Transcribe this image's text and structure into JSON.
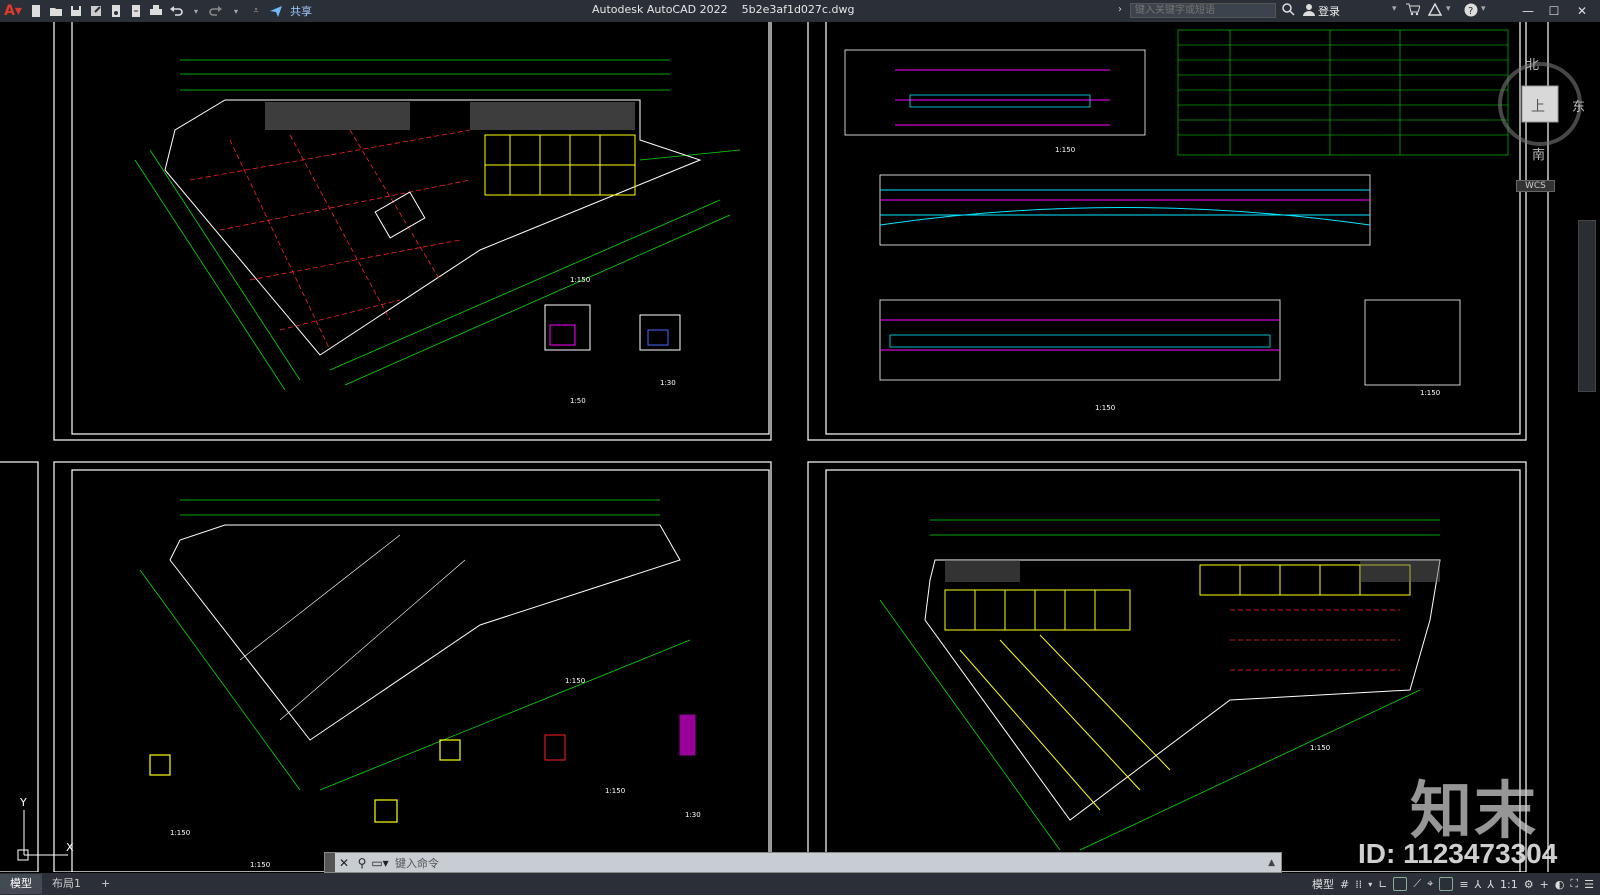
{
  "titlebar": {
    "app_name": "Autodesk AutoCAD 2022",
    "file_name": "5b2e3af1d027c.dwg",
    "share_label": "共享",
    "search_placeholder": "键入关键字或短语",
    "login_label": "登录"
  },
  "command": {
    "placeholder": "键入命令"
  },
  "layout_tabs": [
    "模型",
    "布局1"
  ],
  "status": {
    "model_label": "模型",
    "scale_label": "1:1"
  },
  "viewcube": {
    "north": "北",
    "south": "南",
    "east": "东",
    "top": "上",
    "wcs": "WCS"
  },
  "drawing": {
    "scale_labels": [
      "1:150",
      "1:150",
      "1:150",
      "1:150",
      "1:150",
      "1:150",
      "1:150",
      "1:50",
      "1:30",
      "1:30",
      "1:150",
      "1:150"
    ],
    "ucs_x": "X",
    "ucs_y": "Y"
  },
  "watermark": {
    "brand": "知末",
    "id_text": "ID: 1123473304"
  },
  "colors": {
    "titlebar": "#2b3038",
    "canvas": "#000000",
    "frame": "#ffffff",
    "green": "#00e000",
    "red": "#ff2020",
    "yellow": "#ffff00",
    "magenta": "#ff00ff",
    "cyan": "#00e5ff"
  }
}
